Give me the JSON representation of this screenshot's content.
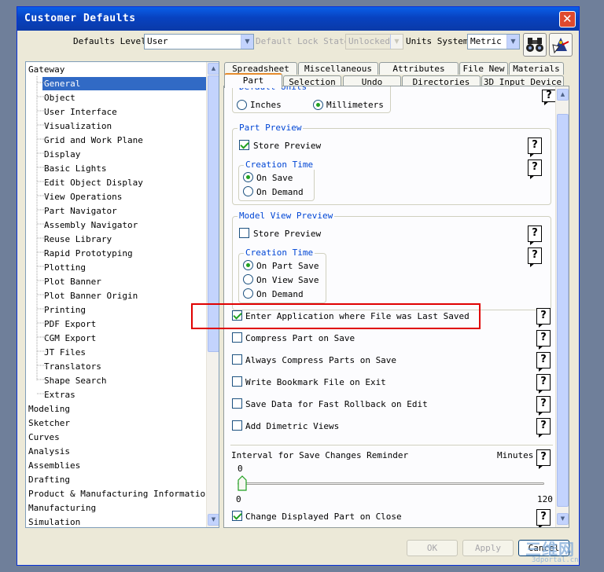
{
  "window": {
    "title": "Customer Defaults",
    "close_glyph": "✕"
  },
  "toolbar": {
    "defaults_level_label": "Defaults Level",
    "defaults_level_value": "User",
    "lock_state_label": "Default Lock State",
    "lock_state_value": "Unlocked",
    "units_label": "Units System",
    "units_value": "Metric",
    "find_icon": "binoculars-icon",
    "settings_icon": "wizard-icon"
  },
  "tree": {
    "items": [
      "Gateway",
      "General",
      "Object",
      "User Interface",
      "Visualization",
      "Grid and Work Plane",
      "Display",
      "Basic Lights",
      "Edit Object Display",
      "View Operations",
      "Part Navigator",
      "Assembly Navigator",
      "Reuse Library",
      "Rapid Prototyping",
      "Plotting",
      "Plot Banner",
      "Plot Banner Origin",
      "Printing",
      "PDF Export",
      "CGM Export",
      "JT Files",
      "Translators",
      "Shape Search",
      "Extras",
      "Modeling",
      "Sketcher",
      "Curves",
      "Analysis",
      "Assemblies",
      "Drafting",
      "Product & Manufacturing Information",
      "Manufacturing",
      "Simulation"
    ],
    "selected": "General"
  },
  "tabs": {
    "row1": [
      "Spreadsheet",
      "Miscellaneous",
      "Attributes",
      "File New",
      "Materials"
    ],
    "row2": [
      "Part",
      "Selection",
      "Undo",
      "Directories",
      "3D Input Device"
    ],
    "active": "Part"
  },
  "panel": {
    "default_units": {
      "title": "Default Units",
      "inches": "Inches",
      "millimeters": "Millimeters",
      "selected": "Millimeters"
    },
    "part_preview": {
      "title": "Part Preview",
      "store_preview": "Store Preview",
      "store_preview_checked": true,
      "creation_time_title": "Creation Time",
      "on_save": "On Save",
      "on_demand": "On Demand",
      "selected": "On Save"
    },
    "model_view_preview": {
      "title": "Model View Preview",
      "store_preview": "Store Preview",
      "store_preview_checked": false,
      "creation_time_title": "Creation Time",
      "on_part_save": "On Part Save",
      "on_view_save": "On View Save",
      "on_demand": "On Demand",
      "selected": "On Part Save"
    },
    "options": [
      {
        "label": "Enter Application where File was Last Saved",
        "checked": true
      },
      {
        "label": "Compress Part on Save",
        "checked": false
      },
      {
        "label": "Always Compress Parts on Save",
        "checked": false
      },
      {
        "label": "Write Bookmark File on Exit",
        "checked": false
      },
      {
        "label": "Save Data for Fast Rollback on Edit",
        "checked": false
      },
      {
        "label": "Add Dimetric Views",
        "checked": false
      }
    ],
    "reminder": {
      "label": "Interval for Save Changes Reminder",
      "units": "Minutes",
      "value": "0",
      "min": "0",
      "max": "120"
    },
    "change_displayed_part": {
      "label": "Change Displayed Part on Close",
      "checked": true
    },
    "help_glyph": "?"
  },
  "buttons": {
    "ok": "OK",
    "apply": "Apply",
    "cancel": "Cancel"
  },
  "watermark": {
    "line1": "三维网",
    "line2": "3dportal.cn"
  }
}
